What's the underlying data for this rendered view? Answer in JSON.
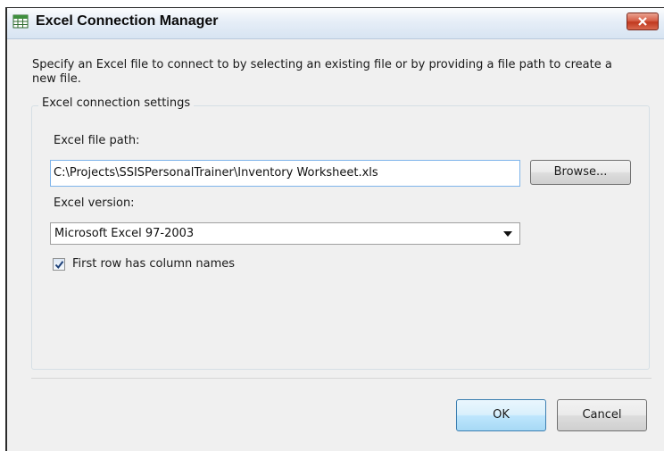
{
  "window": {
    "title": "Excel Connection Manager",
    "icon": "excel-sheet-icon",
    "close_icon": "close-icon"
  },
  "description": "Specify an Excel file to connect to by selecting an existing file or by providing a file path to create a new file.",
  "group": {
    "legend": "Excel connection settings",
    "file_path_label": "Excel file path:",
    "file_path_value": "C:\\Projects\\SSISPersonalTrainer\\Inventory Worksheet.xls",
    "browse_label": "Browse...",
    "version_label": "Excel version:",
    "version_selected": "Microsoft Excel 97-2003",
    "first_row_checkbox": {
      "label": "First row has column names",
      "checked": true
    }
  },
  "buttons": {
    "ok_label": "OK",
    "cancel_label": "Cancel"
  },
  "colors": {
    "title_bar": "#dce7f4",
    "close_button": "#c9452c",
    "focus_border": "#7eb4ea",
    "default_button": "#bee6fd"
  }
}
